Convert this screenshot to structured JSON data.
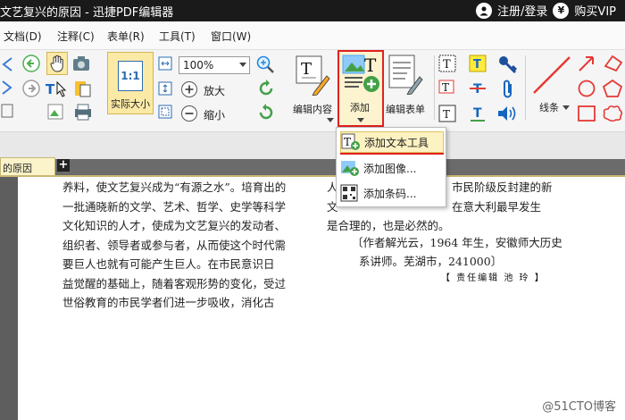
{
  "titlebar": {
    "title": "文艺复兴的原因 - 迅捷PDF编辑器",
    "login": "注册/登录",
    "vip": "购买VIP",
    "vip_symbol": "¥"
  },
  "menu": [
    "文档(D)",
    "注释(C)",
    "表单(R)",
    "工具(T)",
    "窗口(W)"
  ],
  "ribbon": {
    "actual_size_icon_text": "1:1",
    "actual_size": "实际大小",
    "zoom_value": "100%",
    "zoom_in": "放大",
    "zoom_out": "缩小",
    "edit_content": "编辑内容",
    "add": "添加",
    "edit_form": "编辑表单",
    "line": "线条"
  },
  "tab": {
    "label": "的原因",
    "add": "+"
  },
  "dropdown": {
    "items": [
      "添加文本工具",
      "添加图像...",
      "添加条码..."
    ]
  },
  "document": {
    "left_lines": [
      "养料，使文艺复兴成为“有源之水”。培育出的",
      "一批通晓新的文学、艺术、哲学、史学等科学",
      "文化知识的人才，使成为文艺复兴的发动者、",
      "组织者、领导者或参与者，从而使这个时代需",
      "要巨人也就有可能产生巨人。在市民意识日",
      "益觉醒的基础上，随着客观形势的变化，受过",
      "世俗教育的市民学者们进一步吸收，消化古"
    ],
    "right_lines_a": [
      "人",
      "文"
    ],
    "right_lines_b": [
      "市民阶级反封建的新",
      "在意大利最早发生"
    ],
    "right_line_c": "是合理的，也是必然的。",
    "citation_1": "〔作者解光云，1964 年生，安徽师大历史",
    "citation_2": "系讲师。芜湖市，241000〕",
    "signature": "【 责任编辑   池   玲 】"
  },
  "watermark": "@51CTO博客"
}
